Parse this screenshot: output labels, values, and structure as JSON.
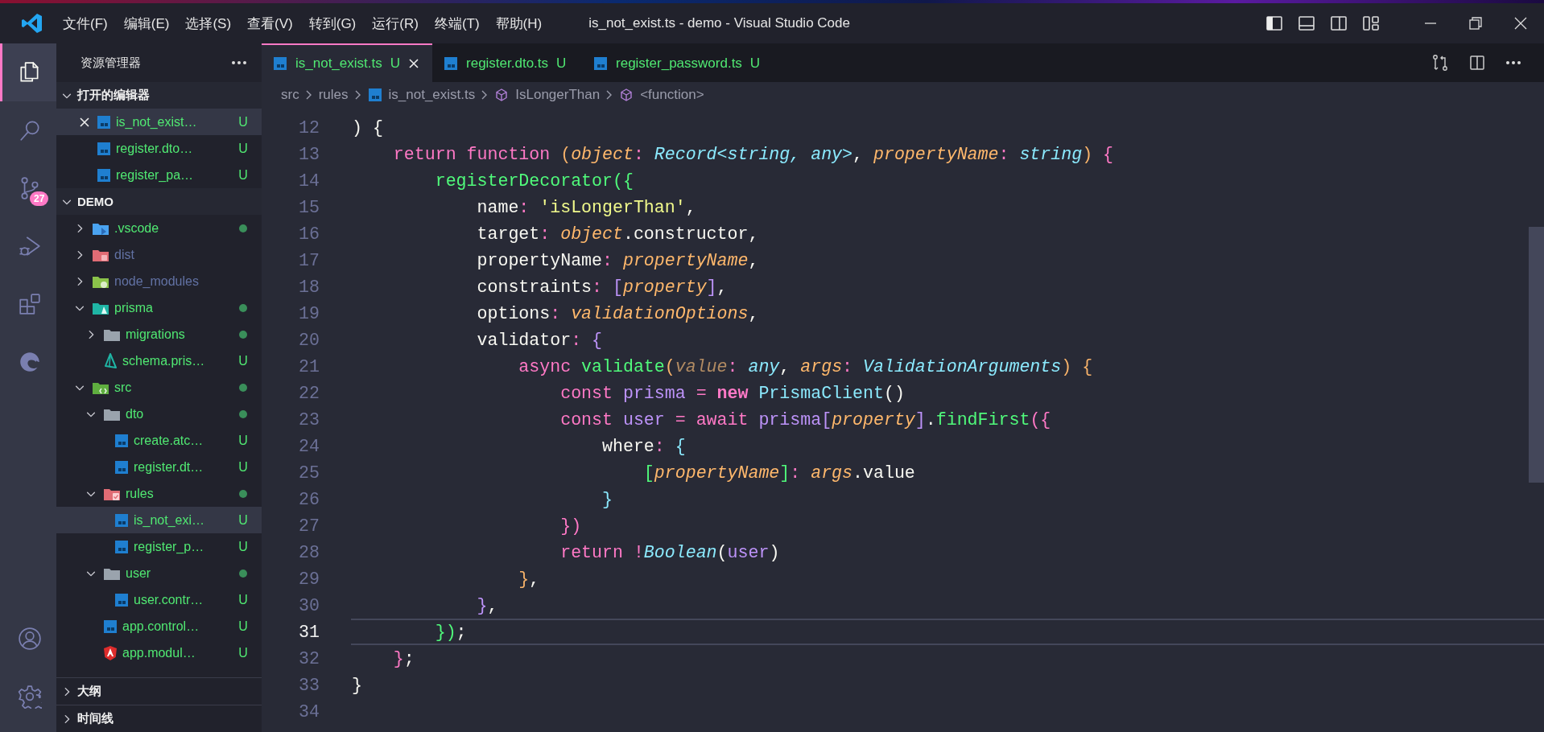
{
  "window": {
    "title": "is_not_exist.ts - demo - Visual Studio Code"
  },
  "menu": [
    "文件(F)",
    "编辑(E)",
    "选择(S)",
    "查看(V)",
    "转到(G)",
    "运行(R)",
    "终端(T)",
    "帮助(H)"
  ],
  "activity_bar": {
    "items": [
      {
        "kind": "explorer",
        "selected": true
      },
      {
        "kind": "search",
        "selected": false
      },
      {
        "kind": "source-control",
        "selected": false,
        "badge": "27"
      },
      {
        "kind": "run",
        "selected": false
      },
      {
        "kind": "extensions",
        "selected": false
      },
      {
        "kind": "browser",
        "selected": false
      }
    ],
    "bottom": [
      {
        "kind": "account"
      },
      {
        "kind": "settings"
      }
    ]
  },
  "sidebar": {
    "title": "资源管理器",
    "open_editors": {
      "title": "打开的编辑器",
      "expanded": true,
      "items": [
        {
          "name": "is_not_exist…",
          "status": "U",
          "selected": true
        },
        {
          "name": "register.dto…",
          "status": "U",
          "selected": false
        },
        {
          "name": "register_pa…",
          "status": "U",
          "selected": false
        }
      ]
    },
    "folder": {
      "title": "DEMO",
      "expanded": true,
      "items": [
        {
          "name": ".vscode",
          "kind": "vscode-folder",
          "expanded": false,
          "dot": true,
          "selected": false
        },
        {
          "name": "dist",
          "kind": "dist-folder",
          "expanded": false,
          "ignored": true,
          "selected": false
        },
        {
          "name": "node_modules",
          "kind": "node-folder",
          "expanded": false,
          "ignored": true,
          "selected": false
        },
        {
          "name": "prisma",
          "kind": "prisma-folder",
          "expanded": true,
          "dot": true,
          "selected": false,
          "children": [
            {
              "name": "migrations",
              "kind": "folder",
              "expanded": false,
              "dot": true,
              "selected": false
            },
            {
              "name": "schema.pris…",
              "kind": "prisma-file",
              "status": "U",
              "selected": false
            }
          ]
        },
        {
          "name": "src",
          "kind": "src-folder",
          "expanded": true,
          "dot": true,
          "selected": false,
          "children": [
            {
              "name": "dto",
              "kind": "folder",
              "expanded": true,
              "dot": true,
              "selected": false,
              "children": [
                {
                  "name": "create.atc…",
                  "kind": "ts",
                  "status": "U",
                  "selected": false
                },
                {
                  "name": "register.dt…",
                  "kind": "ts",
                  "status": "U",
                  "selected": false
                }
              ]
            },
            {
              "name": "rules",
              "kind": "rules-folder",
              "expanded": true,
              "dot": true,
              "selected": false,
              "children": [
                {
                  "name": "is_not_exi…",
                  "kind": "ts",
                  "status": "U",
                  "selected": true
                },
                {
                  "name": "register_p…",
                  "kind": "ts",
                  "status": "U",
                  "selected": false
                }
              ]
            },
            {
              "name": "user",
              "kind": "folder",
              "expanded": true,
              "dot": true,
              "selected": false,
              "children": [
                {
                  "name": "user.contr…",
                  "kind": "ts",
                  "status": "U",
                  "selected": false
                }
              ]
            },
            {
              "name": "app.control…",
              "kind": "ts",
              "status": "U",
              "selected": false
            },
            {
              "name": "app.modul…",
              "kind": "angular",
              "status": "U",
              "selected": false
            }
          ]
        }
      ]
    },
    "sections": [
      {
        "title": "大纲",
        "expanded": false
      },
      {
        "title": "时间线",
        "expanded": false
      }
    ]
  },
  "tabs": [
    {
      "label": "is_not_exist.ts",
      "status": "U",
      "selected": true
    },
    {
      "label": "register.dto.ts",
      "status": "U",
      "selected": false
    },
    {
      "label": "register_password.ts",
      "status": "U",
      "selected": false
    }
  ],
  "breadcrumb": [
    {
      "label": "src",
      "kind": "folder"
    },
    {
      "label": "rules",
      "kind": "folder"
    },
    {
      "label": "is_not_exist.ts",
      "kind": "file"
    },
    {
      "label": "IsLongerThan",
      "kind": "symbol"
    },
    {
      "label": "<function>",
      "kind": "symbol"
    }
  ],
  "editor": {
    "lines": [
      {
        "number": "12",
        "tokens": [
          {
            "kind": "plain",
            "text": ") {"
          }
        ]
      },
      {
        "number": "13",
        "tokens": [
          {
            "kind": "kw",
            "text": "    return function "
          },
          {
            "kind": "b1",
            "text": "("
          },
          {
            "kind": "param",
            "text": "object"
          },
          {
            "kind": "op",
            "text": ": "
          },
          {
            "kind": "type",
            "text": "Record<string, any>"
          },
          {
            "kind": "plain",
            "text": ", "
          },
          {
            "kind": "param",
            "text": "propertyName"
          },
          {
            "kind": "op",
            "text": ": "
          },
          {
            "kind": "type",
            "text": "string"
          },
          {
            "kind": "b1",
            "text": ")"
          },
          {
            "kind": "b2",
            "text": " {"
          }
        ]
      },
      {
        "number": "14",
        "tokens": [
          {
            "kind": "fn",
            "text": "        registerDecorator"
          },
          {
            "kind": "b3",
            "text": "({"
          }
        ]
      },
      {
        "number": "15",
        "tokens": [
          {
            "kind": "plain",
            "text": "            name"
          },
          {
            "kind": "op",
            "text": ": "
          },
          {
            "kind": "str",
            "text": "'isLongerThan'"
          },
          {
            "kind": "plain",
            "text": ","
          }
        ]
      },
      {
        "number": "16",
        "tokens": [
          {
            "kind": "plain",
            "text": "            target"
          },
          {
            "kind": "op",
            "text": ": "
          },
          {
            "kind": "param",
            "text": "object"
          },
          {
            "kind": "plain",
            "text": ".constructor,"
          }
        ]
      },
      {
        "number": "17",
        "tokens": [
          {
            "kind": "plain",
            "text": "            propertyName"
          },
          {
            "kind": "op",
            "text": ": "
          },
          {
            "kind": "param",
            "text": "propertyName"
          },
          {
            "kind": "plain",
            "text": ","
          }
        ]
      },
      {
        "number": "18",
        "tokens": [
          {
            "kind": "plain",
            "text": "            constraints"
          },
          {
            "kind": "op",
            "text": ": "
          },
          {
            "kind": "b4",
            "text": "["
          },
          {
            "kind": "param",
            "text": "property"
          },
          {
            "kind": "b4",
            "text": "]"
          },
          {
            "kind": "plain",
            "text": ","
          }
        ]
      },
      {
        "number": "19",
        "tokens": [
          {
            "kind": "plain",
            "text": "            options"
          },
          {
            "kind": "op",
            "text": ": "
          },
          {
            "kind": "param",
            "text": "validationOptions"
          },
          {
            "kind": "plain",
            "text": ","
          }
        ]
      },
      {
        "number": "20",
        "tokens": [
          {
            "kind": "plain",
            "text": "            validator"
          },
          {
            "kind": "op",
            "text": ": "
          },
          {
            "kind": "b4",
            "text": "{"
          }
        ]
      },
      {
        "number": "21",
        "tokens": [
          {
            "kind": "kw",
            "text": "                async "
          },
          {
            "kind": "fn",
            "text": "validate"
          },
          {
            "kind": "b1",
            "text": "("
          },
          {
            "kind": "dim",
            "text": "value"
          },
          {
            "kind": "op",
            "text": ": "
          },
          {
            "kind": "type",
            "text": "any"
          },
          {
            "kind": "plain",
            "text": ", "
          },
          {
            "kind": "param",
            "text": "args"
          },
          {
            "kind": "op",
            "text": ": "
          },
          {
            "kind": "type",
            "text": "ValidationArguments"
          },
          {
            "kind": "b1",
            "text": ") {"
          }
        ]
      },
      {
        "number": "22",
        "tokens": [
          {
            "kind": "kw",
            "text": "                    const "
          },
          {
            "kind": "var",
            "text": "prisma "
          },
          {
            "kind": "kw",
            "text": "= "
          },
          {
            "kind": "kwb",
            "text": "new "
          },
          {
            "kind": "cls",
            "text": "PrismaClient"
          },
          {
            "kind": "plain",
            "text": "()"
          }
        ]
      },
      {
        "number": "23",
        "tokens": [
          {
            "kind": "kw",
            "text": "                    const "
          },
          {
            "kind": "var",
            "text": "user "
          },
          {
            "kind": "kw",
            "text": "= await "
          },
          {
            "kind": "var",
            "text": "prisma"
          },
          {
            "kind": "b4",
            "text": "["
          },
          {
            "kind": "param",
            "text": "property"
          },
          {
            "kind": "b4",
            "text": "]"
          },
          {
            "kind": "plain",
            "text": "."
          },
          {
            "kind": "fn",
            "text": "findFirst"
          },
          {
            "kind": "b2",
            "text": "({"
          }
        ]
      },
      {
        "number": "24",
        "tokens": [
          {
            "kind": "plain",
            "text": "                        where"
          },
          {
            "kind": "op",
            "text": ": "
          },
          {
            "kind": "b5",
            "text": "{"
          }
        ]
      },
      {
        "number": "25",
        "tokens": [
          {
            "kind": "b3",
            "text": "                            ["
          },
          {
            "kind": "param",
            "text": "propertyName"
          },
          {
            "kind": "b3",
            "text": "]"
          },
          {
            "kind": "op",
            "text": ": "
          },
          {
            "kind": "param",
            "text": "args"
          },
          {
            "kind": "plain",
            "text": ".value"
          }
        ]
      },
      {
        "number": "26",
        "tokens": [
          {
            "kind": "b5",
            "text": "                        }"
          }
        ]
      },
      {
        "number": "27",
        "tokens": [
          {
            "kind": "b2",
            "text": "                    })"
          }
        ]
      },
      {
        "number": "28",
        "tokens": [
          {
            "kind": "kw",
            "text": "                    return !"
          },
          {
            "kind": "type",
            "text": "Boolean"
          },
          {
            "kind": "plain",
            "text": "("
          },
          {
            "kind": "var",
            "text": "user"
          },
          {
            "kind": "plain",
            "text": ")"
          }
        ]
      },
      {
        "number": "29",
        "tokens": [
          {
            "kind": "b1",
            "text": "                }"
          },
          {
            "kind": "plain",
            "text": ","
          }
        ]
      },
      {
        "number": "30",
        "tokens": [
          {
            "kind": "b4",
            "text": "            }"
          },
          {
            "kind": "plain",
            "text": ","
          }
        ]
      },
      {
        "number": "31",
        "current": true,
        "tokens": [
          {
            "kind": "b3",
            "text": "        })"
          },
          {
            "kind": "plain",
            "text": ";"
          }
        ]
      },
      {
        "number": "32",
        "tokens": [
          {
            "kind": "b2",
            "text": "    }"
          },
          {
            "kind": "plain",
            "text": ";"
          }
        ]
      },
      {
        "number": "33",
        "tokens": [
          {
            "kind": "plain",
            "text": "}"
          }
        ]
      },
      {
        "number": "34"
      }
    ]
  }
}
